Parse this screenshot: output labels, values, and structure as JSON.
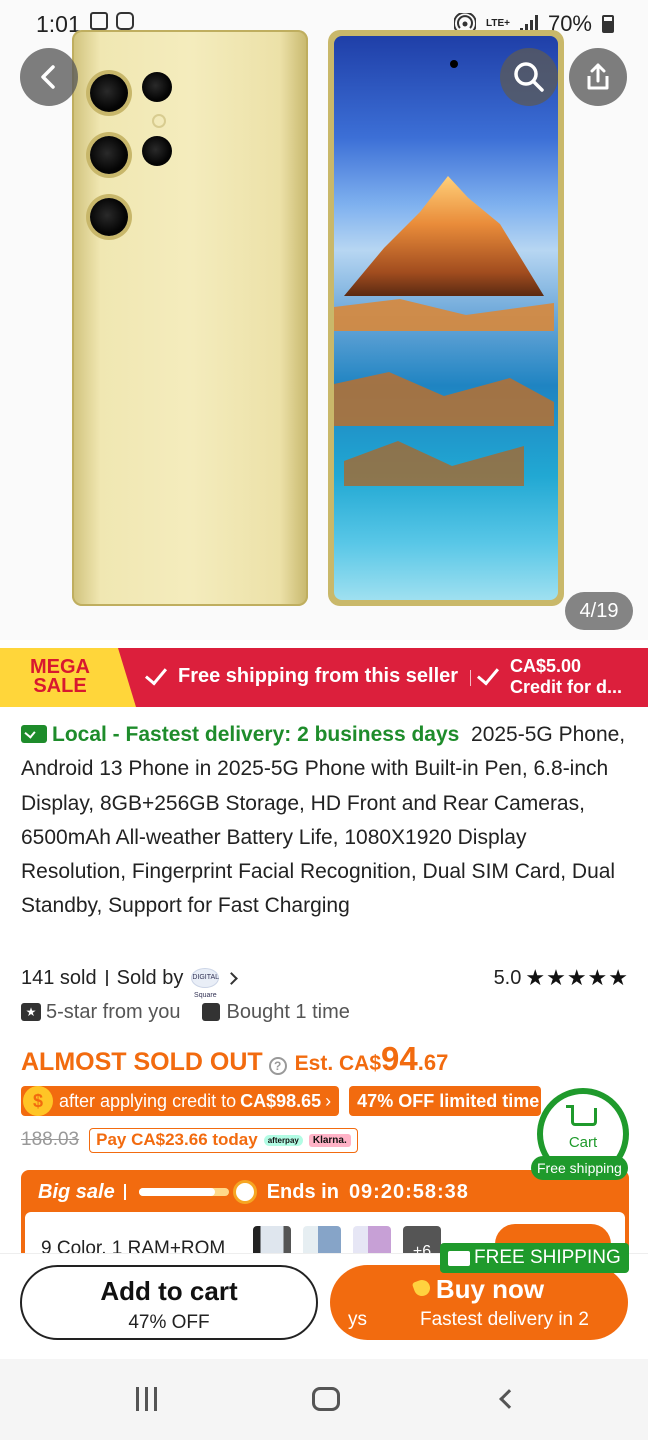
{
  "status_bar": {
    "time": "1:01",
    "network": "LTE+",
    "battery": "70%"
  },
  "gallery": {
    "counter": "4/19"
  },
  "sale_banner": {
    "mega_line1": "MEGA",
    "mega_line2": "SALE",
    "shipping": "Free shipping from this seller",
    "credit_line1": "CA$5.00",
    "credit_line2": "Credit for d..."
  },
  "product": {
    "local_delivery": "Local - Fastest delivery: 2 business days",
    "title": "2025-5G Phone, Android 13 Phone in 2025-5G Phone with Built-in Pen, 6.8-inch Display, 8GB+256GB Storage, HD Front and Rear Cameras, 6500mAh All-weather Battery Life, 1080X1920 Display Resolution, Fingerprint Facial Recognition, Dual SIM Card, Dual Standby, Support for Fast Charging",
    "sold": "141 sold",
    "sold_by": "Sold by",
    "seller_logo_text": "DIGITAL Square",
    "rating": "5.0",
    "stars": "★★★★★",
    "five_star": "5-star from you",
    "bought": "Bought 1 time"
  },
  "price": {
    "almost_sold_out": "ALMOST SOLD OUT",
    "est_label": "Est. CA$",
    "price_int": "94",
    "price_cents": ".67",
    "credit_text": "after applying credit to",
    "credit_price": "CA$98.65",
    "off_text": "47% OFF limited time",
    "original": "188.03",
    "pay_today": "Pay CA$23.66 today",
    "afterpay": "afterpay",
    "klarna": "Klarna."
  },
  "cart": {
    "label": "Cart",
    "free_shipping": "Free shipping"
  },
  "big_sale": {
    "label": "Big sale",
    "progress": 0.85,
    "ends_label": "Ends in",
    "countdown": "09:20:58:38",
    "variant_text": "9 Color, 1 RAM+ROM",
    "more_count": "+6"
  },
  "actions": {
    "free_shipping_tag": "FREE SHIPPING",
    "add_to_cart": "Add to cart",
    "add_to_cart_sub": "47% OFF",
    "buy_now": "Buy now",
    "buy_sub_left": "ys",
    "buy_sub_right": "Fastest delivery in 2"
  }
}
